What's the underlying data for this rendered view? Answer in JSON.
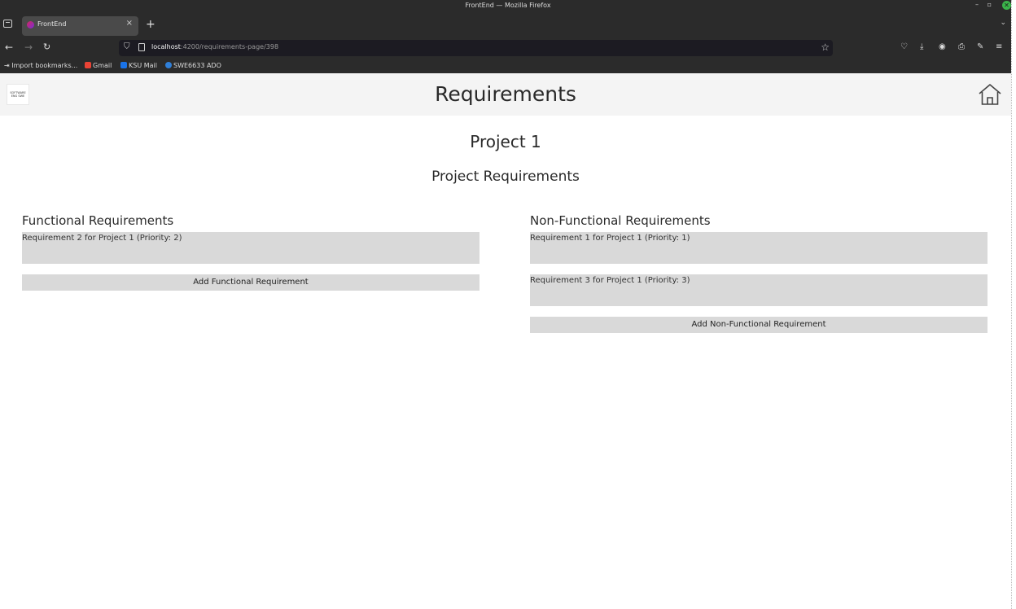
{
  "browser": {
    "window_title": "FrontEnd — Mozilla Firefox",
    "window_controls": {
      "minimize": "–",
      "maximize": "▫",
      "close": "✕"
    },
    "tab_label": "FrontEnd",
    "url_host": "localhost",
    "url_rest": ":4200/requirements-page/398",
    "bookmarks": [
      {
        "label": "Import bookmarks...",
        "icon": "import-icon"
      },
      {
        "label": "Gmail",
        "icon": "gmail-icon",
        "color": "#ea4335"
      },
      {
        "label": "KSU Mail",
        "icon": "outlook-icon",
        "color": "#1a73e8"
      },
      {
        "label": "SWE6633 ADO",
        "icon": "azure-devops-icon",
        "color": "#2f7fd8"
      }
    ]
  },
  "header": {
    "logo_text": "SOFTWARE ENG SWE",
    "title": "Requirements"
  },
  "project": {
    "name": "Project 1",
    "section_title": "Project Requirements"
  },
  "functional": {
    "title": "Functional Requirements",
    "items": [
      "Requirement 2 for Project 1 (Priority: 2)"
    ],
    "add_label": "Add Functional Requirement"
  },
  "non_functional": {
    "title": "Non-Functional Requirements",
    "items": [
      "Requirement 1 for Project 1 (Priority: 1)",
      "Requirement 3 for Project 1 (Priority: 3)"
    ],
    "add_label": "Add Non-Functional Requirement"
  },
  "colors": {
    "header_bg": "#f4f4f4",
    "item_bg": "#d9d9d9",
    "browser_chrome": "#2b2b2b"
  }
}
